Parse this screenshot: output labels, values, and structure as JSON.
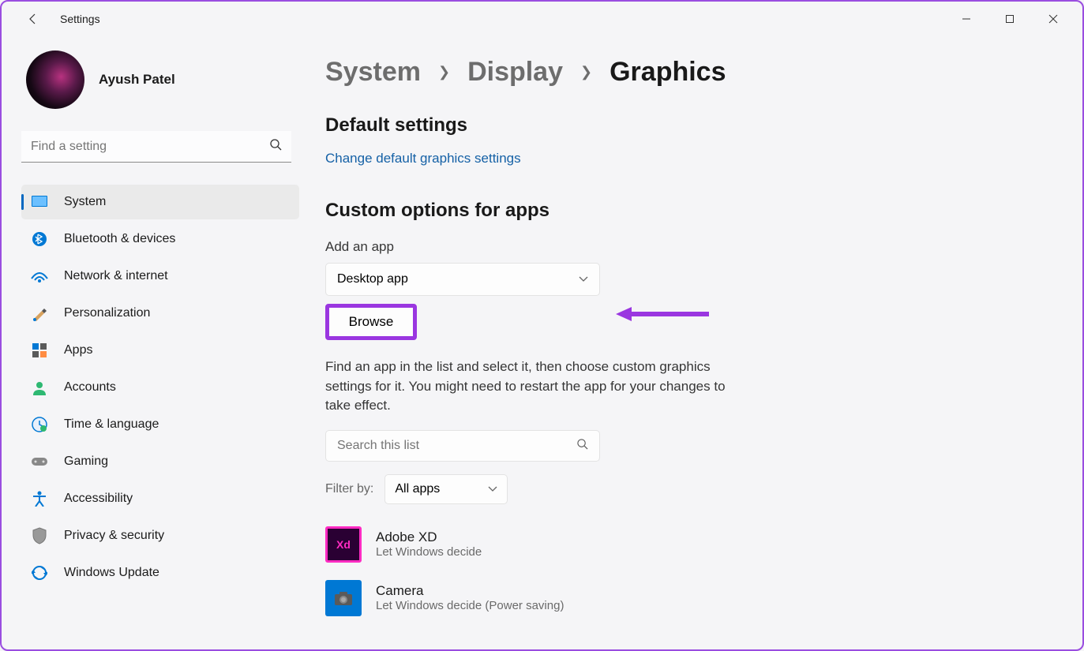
{
  "window": {
    "title": "Settings"
  },
  "profile": {
    "name": "Ayush Patel"
  },
  "search": {
    "placeholder": "Find a setting"
  },
  "nav": {
    "items": [
      {
        "label": "System",
        "icon": "system",
        "active": true
      },
      {
        "label": "Bluetooth & devices",
        "icon": "bluetooth"
      },
      {
        "label": "Network & internet",
        "icon": "network"
      },
      {
        "label": "Personalization",
        "icon": "personalization"
      },
      {
        "label": "Apps",
        "icon": "apps"
      },
      {
        "label": "Accounts",
        "icon": "accounts"
      },
      {
        "label": "Time & language",
        "icon": "time"
      },
      {
        "label": "Gaming",
        "icon": "gaming"
      },
      {
        "label": "Accessibility",
        "icon": "accessibility"
      },
      {
        "label": "Privacy & security",
        "icon": "privacy"
      },
      {
        "label": "Windows Update",
        "icon": "update"
      }
    ]
  },
  "breadcrumbs": {
    "level1": "System",
    "level2": "Display",
    "level3": "Graphics"
  },
  "sections": {
    "default": {
      "title": "Default settings",
      "link": "Change default graphics settings"
    },
    "custom": {
      "title": "Custom options for apps",
      "add_app_label": "Add an app",
      "dropdown_value": "Desktop app",
      "browse_label": "Browse",
      "helper": "Find an app in the list and select it, then choose custom graphics settings for it. You might need to restart the app for your changes to take effect.",
      "search_placeholder": "Search this list",
      "filter_label": "Filter by:",
      "filter_value": "All apps",
      "apps": [
        {
          "name": "Adobe XD",
          "subtitle": "Let Windows decide",
          "icon": "xd"
        },
        {
          "name": "Camera",
          "subtitle": "Let Windows decide (Power saving)",
          "icon": "camera"
        }
      ]
    }
  }
}
